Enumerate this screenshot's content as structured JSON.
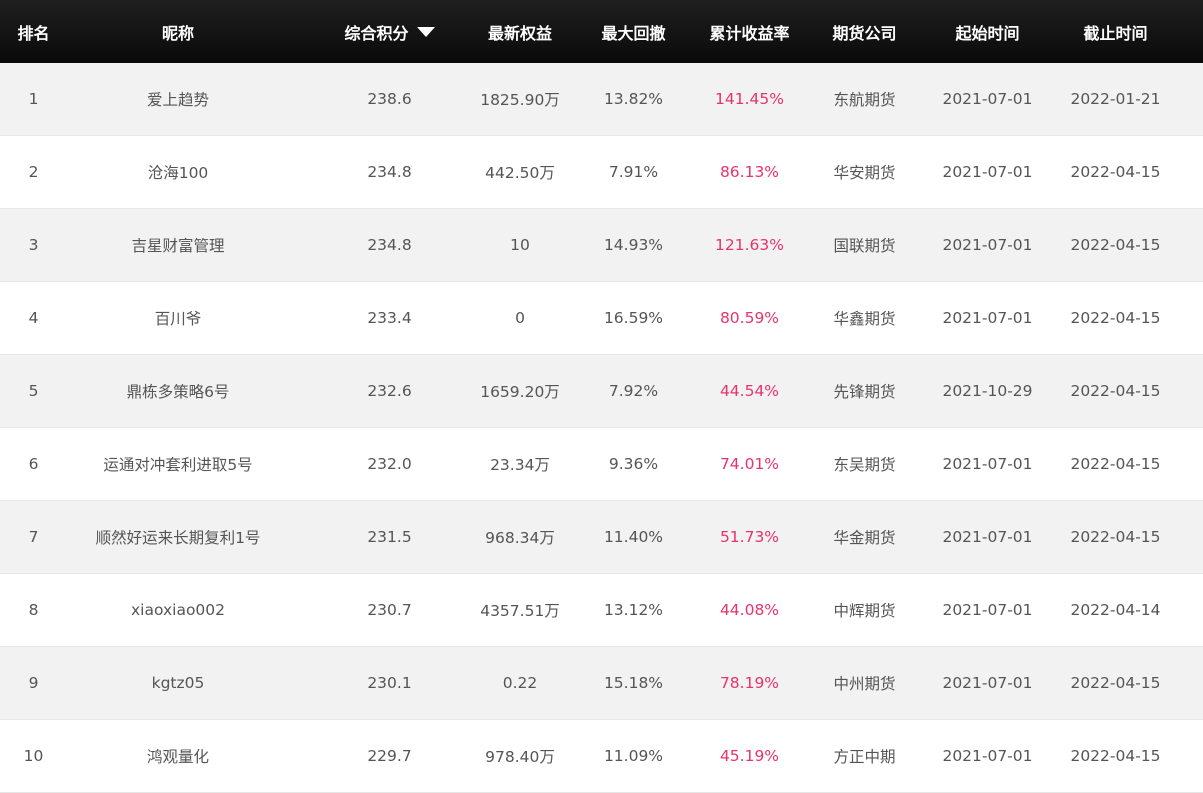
{
  "table": {
    "columns": {
      "rank": "排名",
      "name": "昵称",
      "score": "综合积分",
      "equity": "最新权益",
      "drawdown": "最大回撤",
      "return": "累计收益率",
      "broker": "期货公司",
      "start": "起始时间",
      "end": "截止时间"
    },
    "sort_icon": "caret-down-icon",
    "accent_color": "#e8336d",
    "rows": [
      {
        "rank": "1",
        "name": "爱上趋势",
        "score": "238.6",
        "equity": "1825.90万",
        "drawdown": "13.82%",
        "return": "141.45%",
        "broker": "东航期货",
        "start": "2021-07-01",
        "end": "2022-01-21"
      },
      {
        "rank": "2",
        "name": "沧海100",
        "score": "234.8",
        "equity": "442.50万",
        "drawdown": "7.91%",
        "return": "86.13%",
        "broker": "华安期货",
        "start": "2021-07-01",
        "end": "2022-04-15"
      },
      {
        "rank": "3",
        "name": "吉星财富管理",
        "score": "234.8",
        "equity": "10",
        "drawdown": "14.93%",
        "return": "121.63%",
        "broker": "国联期货",
        "start": "2021-07-01",
        "end": "2022-04-15"
      },
      {
        "rank": "4",
        "name": "百川爷",
        "score": "233.4",
        "equity": "0",
        "drawdown": "16.59%",
        "return": "80.59%",
        "broker": "华鑫期货",
        "start": "2021-07-01",
        "end": "2022-04-15"
      },
      {
        "rank": "5",
        "name": "鼎栋多策略6号",
        "score": "232.6",
        "equity": "1659.20万",
        "drawdown": "7.92%",
        "return": "44.54%",
        "broker": "先锋期货",
        "start": "2021-10-29",
        "end": "2022-04-15"
      },
      {
        "rank": "6",
        "name": "运通对冲套利进取5号",
        "score": "232.0",
        "equity": "23.34万",
        "drawdown": "9.36%",
        "return": "74.01%",
        "broker": "东吴期货",
        "start": "2021-07-01",
        "end": "2022-04-15"
      },
      {
        "rank": "7",
        "name": "顺然好运来长期复利1号",
        "score": "231.5",
        "equity": "968.34万",
        "drawdown": "11.40%",
        "return": "51.73%",
        "broker": "华金期货",
        "start": "2021-07-01",
        "end": "2022-04-15"
      },
      {
        "rank": "8",
        "name": "xiaoxiao002",
        "score": "230.7",
        "equity": "4357.51万",
        "drawdown": "13.12%",
        "return": "44.08%",
        "broker": "中辉期货",
        "start": "2021-07-01",
        "end": "2022-04-14"
      },
      {
        "rank": "9",
        "name": "kgtz05",
        "score": "230.1",
        "equity": "0.22",
        "drawdown": "15.18%",
        "return": "78.19%",
        "broker": "中州期货",
        "start": "2021-07-01",
        "end": "2022-04-15"
      },
      {
        "rank": "10",
        "name": "鸿观量化",
        "score": "229.7",
        "equity": "978.40万",
        "drawdown": "11.09%",
        "return": "45.19%",
        "broker": "方正中期",
        "start": "2021-07-01",
        "end": "2022-04-15"
      }
    ]
  }
}
